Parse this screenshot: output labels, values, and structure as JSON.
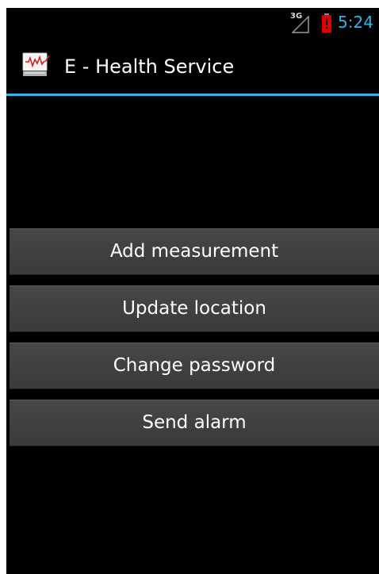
{
  "status_bar": {
    "network_type": "3G",
    "time": "5:24",
    "signal_icon": "signal-strength-icon",
    "battery_icon": "battery-low-icon",
    "colors": {
      "clock": "#33b5e5",
      "battery_alert": "#e00000"
    }
  },
  "action_bar": {
    "title": "E - Health Service",
    "icon": "health-monitor-icon",
    "divider_color": "#33b5e5"
  },
  "menu": {
    "buttons": [
      {
        "label": "Add measurement"
      },
      {
        "label": "Update location"
      },
      {
        "label": "Change password"
      },
      {
        "label": "Send alarm"
      }
    ]
  }
}
